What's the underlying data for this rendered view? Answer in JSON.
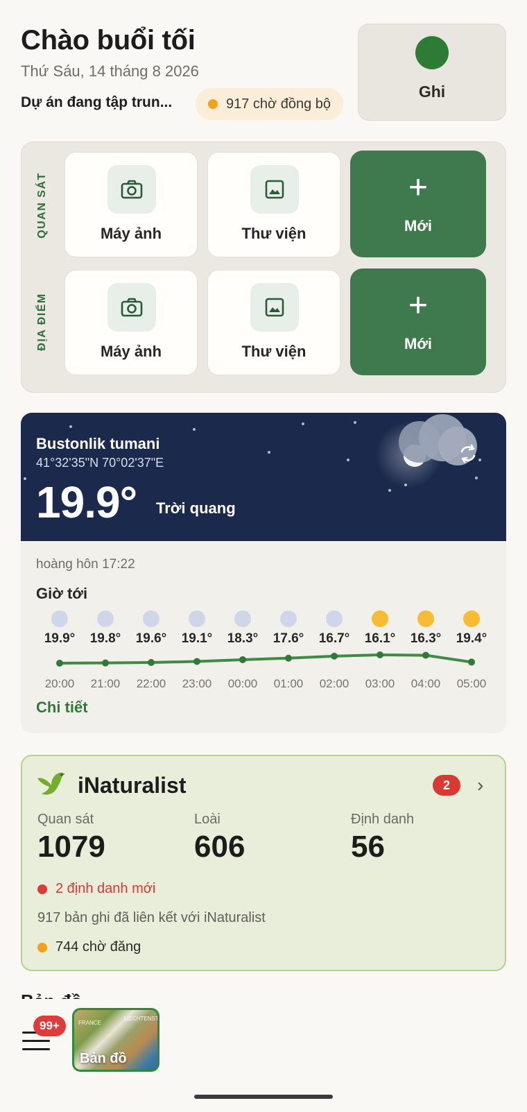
{
  "header": {
    "greeting": "Chào buổi tối",
    "date": "Thứ Sáu, 14 tháng 8 2026",
    "project": "Dự án đang tập trun...",
    "sync_pending": "917 chờ đồng bộ",
    "record_label": "Ghi"
  },
  "capture": {
    "observation_label": "QUAN SÁT",
    "location_label": "ĐỊA ĐIỂM",
    "camera_label": "Máy ảnh",
    "gallery_label": "Thư viện",
    "new_label": "Mới"
  },
  "weather": {
    "location": "Bustonlik tumani",
    "coords": "41°32'35\"N 70°02'37\"E",
    "temperature": "19.9°",
    "condition": "Trời quang",
    "sunset": "hoàng hôn 17:22",
    "hourly_title": "Giờ tới",
    "details_label": "Chi tiết",
    "hourly": [
      {
        "time": "20:00",
        "temp": "19.9°",
        "value": 19.9,
        "icon": "moon"
      },
      {
        "time": "21:00",
        "temp": "19.8°",
        "value": 19.8,
        "icon": "moon"
      },
      {
        "time": "22:00",
        "temp": "19.6°",
        "value": 19.6,
        "icon": "moon"
      },
      {
        "time": "23:00",
        "temp": "19.1°",
        "value": 19.1,
        "icon": "moon"
      },
      {
        "time": "00:00",
        "temp": "18.3°",
        "value": 18.3,
        "icon": "moon"
      },
      {
        "time": "01:00",
        "temp": "17.6°",
        "value": 17.6,
        "icon": "moon"
      },
      {
        "time": "02:00",
        "temp": "16.7°",
        "value": 16.7,
        "icon": "moon"
      },
      {
        "time": "03:00",
        "temp": "16.1°",
        "value": 16.1,
        "icon": "sun"
      },
      {
        "time": "04:00",
        "temp": "16.3°",
        "value": 16.3,
        "icon": "sun"
      },
      {
        "time": "05:00",
        "temp": "19.4°",
        "value": 19.4,
        "icon": "sun"
      }
    ]
  },
  "inaturalist": {
    "title": "iNaturalist",
    "badge": "2",
    "observations_label": "Quan sát",
    "observations": "1079",
    "species_label": "Loài",
    "species": "606",
    "identifications_label": "Định danh",
    "identifications": "56",
    "new_ids": "2 định danh mới",
    "linked": "917 bản ghi đã liên kết với iNaturalist",
    "pending": "744 chờ đăng"
  },
  "bottom": {
    "section_heading": "Bản đồ",
    "menu_badge": "99+",
    "map_label": "Bản đồ",
    "map_text_france": "FRANCE",
    "map_text_liechtenstein": "LIECHTENST"
  },
  "colors": {
    "accent_green": "#3e7a4d",
    "weather_bg": "#1b2a4c",
    "badge_red": "#e03b3b",
    "sync_orange": "#f4a11a"
  }
}
